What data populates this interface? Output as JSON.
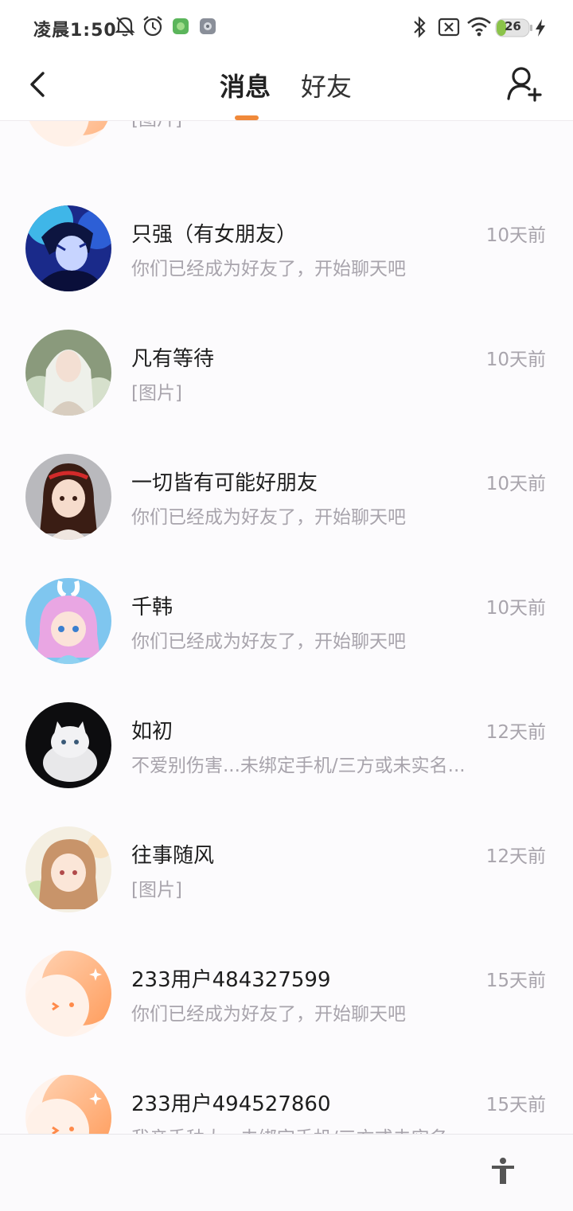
{
  "status_bar": {
    "time": "凌晨1:50",
    "battery": "26"
  },
  "header": {
    "tab_messages": "消息",
    "tab_friends": "好友"
  },
  "conversations": [
    {
      "name": "",
      "message": "[图片]",
      "time": "",
      "avatar": "default-orange"
    },
    {
      "name": "只强（有女朋友）",
      "message": "你们已经成为好友了，开始聊天吧",
      "time": "10天前",
      "avatar": "anime-boy-blue"
    },
    {
      "name": "凡有等待",
      "message": "[图片]",
      "time": "10天前",
      "avatar": "girl-white-hair"
    },
    {
      "name": "一切皆有可能好朋友",
      "message": "你们已经成为好友了，开始聊天吧",
      "time": "10天前",
      "avatar": "anime-girl-headband"
    },
    {
      "name": "千韩",
      "message": "你们已经成为好友了，开始聊天吧",
      "time": "10天前",
      "avatar": "anime-girl-pink"
    },
    {
      "name": "如初",
      "message": "不爱别伤害...未绑定手机/三方或未实名...",
      "time": "12天前",
      "avatar": "white-cat"
    },
    {
      "name": "往事随风",
      "message": "[图片]",
      "time": "12天前",
      "avatar": "anime-girl-flowers"
    },
    {
      "name": "233用户484327599",
      "message": "你们已经成为好友了，开始聊天吧",
      "time": "15天前",
      "avatar": "default-orange"
    },
    {
      "name": "233用户494527860",
      "message": "我亲手种大...未绑定手机/三方或未实名...",
      "time": "15天前",
      "avatar": "default-orange"
    }
  ],
  "colors": {
    "accent": "#f0893a",
    "name_text": "#1e1e1e",
    "secondary_text": "#a8a4ac"
  }
}
